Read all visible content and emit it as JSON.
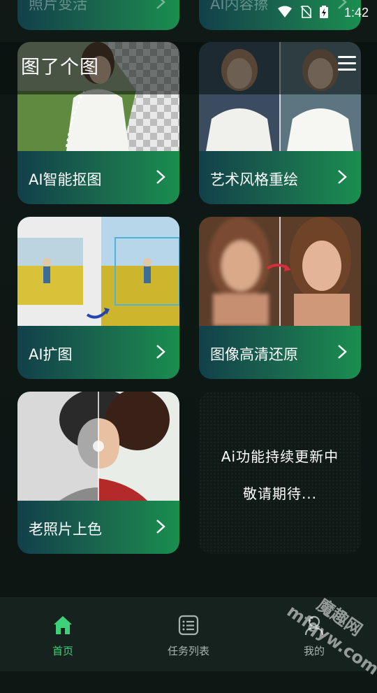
{
  "status": {
    "time": "1:42"
  },
  "header": {
    "title": "图了个图"
  },
  "partial_cards": [
    {
      "label": "照片变活"
    },
    {
      "label": "AI内容擦"
    }
  ],
  "cards": [
    {
      "label": "AI智能抠图"
    },
    {
      "label": "艺术风格重绘"
    },
    {
      "label": "AI扩图"
    },
    {
      "label": "图像高清还原"
    },
    {
      "label": "老照片上色"
    }
  ],
  "coming_soon": {
    "line1": "Ai功能持续更新中",
    "line2": "敬请期待..."
  },
  "nav": [
    {
      "label": "首页",
      "icon": "home-icon",
      "active": true
    },
    {
      "label": "任务列表",
      "icon": "list-icon",
      "active": false
    },
    {
      "label": "我的",
      "icon": "profile-icon",
      "active": false
    }
  ],
  "watermark": {
    "line1": "魔趣网",
    "line2": "mfqyw.com"
  },
  "colors": {
    "accent": "#3fd07a",
    "card_gradient_start": "#12404a",
    "card_gradient_end": "#1a8e4f",
    "background": "#0d1714"
  }
}
